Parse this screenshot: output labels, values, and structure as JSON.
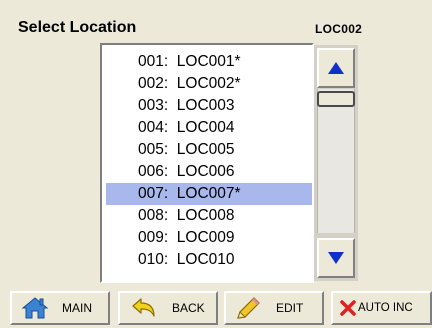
{
  "header": {
    "title": "Select Location",
    "current_location": "LOC002"
  },
  "list": {
    "selected_index": 6,
    "items": [
      {
        "label": "001:  LOC001*"
      },
      {
        "label": "002:  LOC002*"
      },
      {
        "label": "003:  LOC003"
      },
      {
        "label": "004:  LOC004"
      },
      {
        "label": "005:  LOC005"
      },
      {
        "label": "006:  LOC006"
      },
      {
        "label": "007:  LOC007*"
      },
      {
        "label": "008:  LOC008"
      },
      {
        "label": "009:  LOC009"
      },
      {
        "label": "010:  LOC010"
      }
    ]
  },
  "scrollbar": {
    "up_icon": "arrow-up-icon",
    "down_icon": "arrow-down-icon",
    "arrow_color": "#1030c8"
  },
  "toolbar": {
    "main_label": "MAIN",
    "back_label": "BACK",
    "edit_label": "EDIT",
    "auto_inc_label": "AUTO INC"
  },
  "colors": {
    "background": "#ece9d8",
    "selection": "#a8b8ec",
    "delete_red": "#e02020"
  }
}
